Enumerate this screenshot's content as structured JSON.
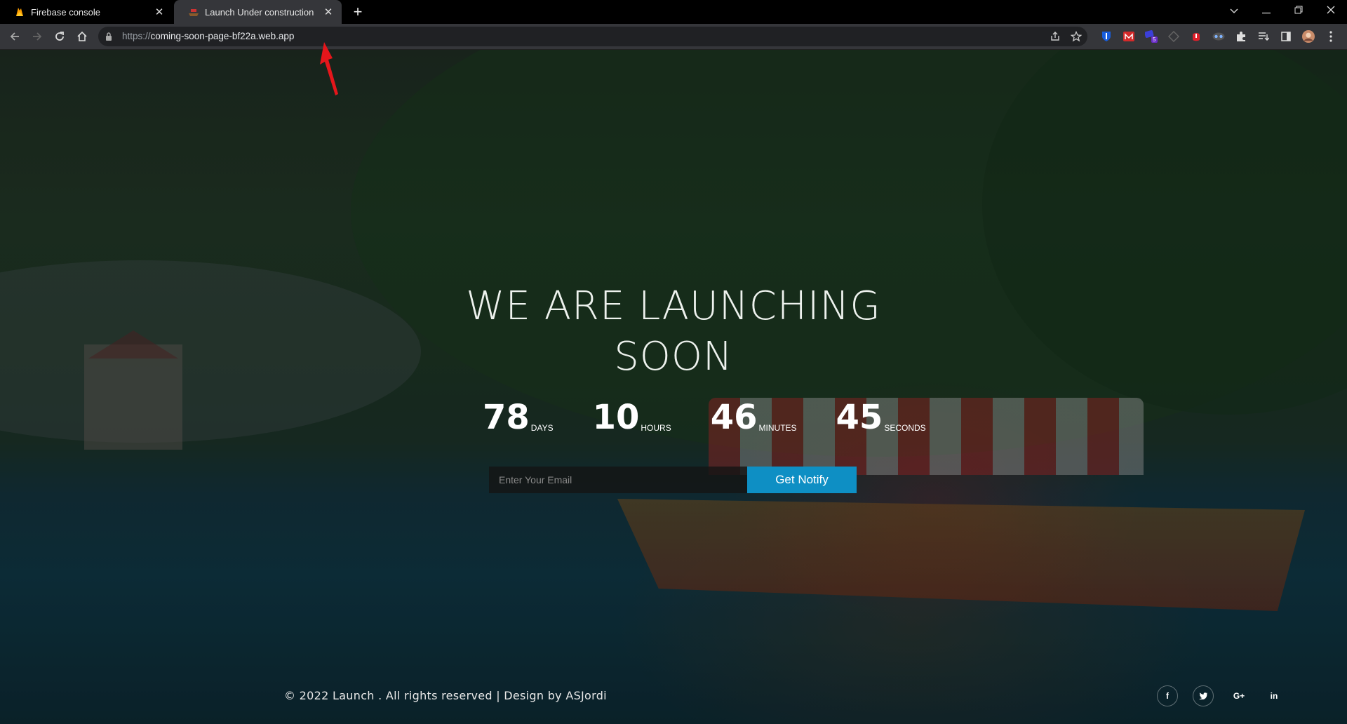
{
  "tabs": [
    {
      "title": "Firebase console",
      "favicon": "firebase-flame-icon",
      "active": false
    },
    {
      "title": "Launch Under construction",
      "favicon": "boat-icon",
      "active": true
    }
  ],
  "address_bar": {
    "scheme": "https://",
    "host": "coming-soon-page-bf22a.web.app"
  },
  "page": {
    "headline_line1": "WE ARE LAUNCHING",
    "headline_line2": "SOON",
    "countdown": [
      {
        "value": "78",
        "label": "DAYS"
      },
      {
        "value": "10",
        "label": "HOURS"
      },
      {
        "value": "46",
        "label": "MINUTES"
      },
      {
        "value": "45",
        "label": "SECONDS"
      }
    ],
    "email_placeholder": "Enter Your Email",
    "notify_label": "Get Notify",
    "footer": "© 2022 Launch . All rights reserved | Design by ASJordi",
    "social": [
      {
        "icon": "facebook-icon",
        "glyph": "f"
      },
      {
        "icon": "twitter-icon",
        "glyph": "🐦"
      },
      {
        "icon": "google-plus-icon",
        "glyph": "G+"
      },
      {
        "icon": "linkedin-icon",
        "glyph": "in"
      }
    ]
  },
  "extension_badge": "5",
  "colors": {
    "accent_button": "#0e8fc4",
    "annotation_arrow": "#e5161b",
    "tab_active_bg": "#35363a"
  }
}
